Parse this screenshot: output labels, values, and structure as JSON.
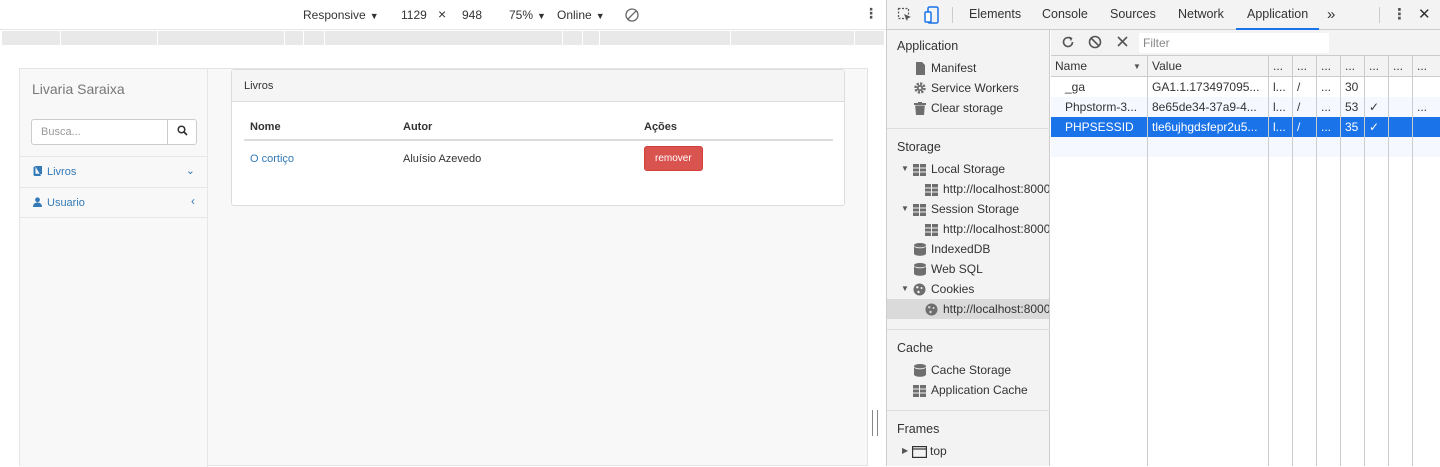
{
  "device_toolbar": {
    "mode": "Responsive",
    "width": "1129",
    "times": "×",
    "height": "948",
    "zoom": "75%",
    "network": "Online"
  },
  "site": {
    "brand": "Livaria Saraixa",
    "search_placeholder": "Busca...",
    "nav": [
      {
        "label": "Livros",
        "icon": "book-icon",
        "arrow": "chevron-down-icon"
      },
      {
        "label": "Usuario",
        "icon": "user-icon",
        "arrow": "chevron-left-icon"
      }
    ],
    "panel_title": "Livros",
    "table": {
      "headers": [
        "Nome",
        "Autor",
        "Ações"
      ],
      "rows": [
        {
          "nome": "O cortiço",
          "autor": "Aluísio Azevedo",
          "acao": "remover"
        }
      ]
    },
    "colors": {
      "link": "#337ab7",
      "danger": "#d9534f"
    }
  },
  "devtools": {
    "tabs": [
      "Elements",
      "Console",
      "Sources",
      "Network",
      "Application"
    ],
    "active_tab": "Application",
    "more": "»",
    "sidebar": {
      "application": {
        "title": "Application",
        "items": [
          {
            "label": "Manifest",
            "icon": "document-icon"
          },
          {
            "label": "Service Workers",
            "icon": "gear-icon"
          },
          {
            "label": "Clear storage",
            "icon": "trash-icon"
          }
        ]
      },
      "storage": {
        "title": "Storage",
        "local_storage": "Local Storage",
        "local_origin": "http://localhost:8000",
        "session_storage": "Session Storage",
        "session_origin": "http://localhost:8000",
        "indexeddb": "IndexedDB",
        "websql": "Web SQL",
        "cookies": "Cookies",
        "cookies_origin": "http://localhost:8000"
      },
      "cache": {
        "title": "Cache",
        "items": [
          {
            "label": "Cache Storage",
            "icon": "database-icon"
          },
          {
            "label": "Application Cache",
            "icon": "grid-icon"
          }
        ]
      },
      "frames": {
        "title": "Frames",
        "top": "top"
      }
    },
    "cookies": {
      "filter_placeholder": "Filter",
      "columns": [
        "Name",
        "Value",
        "...",
        "...",
        "...",
        "...",
        "...",
        "...",
        "..."
      ],
      "rows": [
        {
          "name": "_ga",
          "value": "GA1.1.173497095...",
          "domain": "l...",
          "path": "/",
          "expires": "...",
          "size": "30",
          "http": "",
          "secure": "",
          "same": ""
        },
        {
          "name": "Phpstorm-3...",
          "value": "8e65de34-37a9-4...",
          "domain": "l...",
          "path": "/",
          "expires": "...",
          "size": "53",
          "http": "✓",
          "secure": "",
          "same": "..."
        },
        {
          "name": "PHPSESSID",
          "value": "tle6ujhgdsfepr2u5...",
          "domain": "l...",
          "path": "/",
          "expires": "...",
          "size": "35",
          "http": "✓",
          "secure": "",
          "same": ""
        }
      ],
      "selected_row": 2
    }
  }
}
